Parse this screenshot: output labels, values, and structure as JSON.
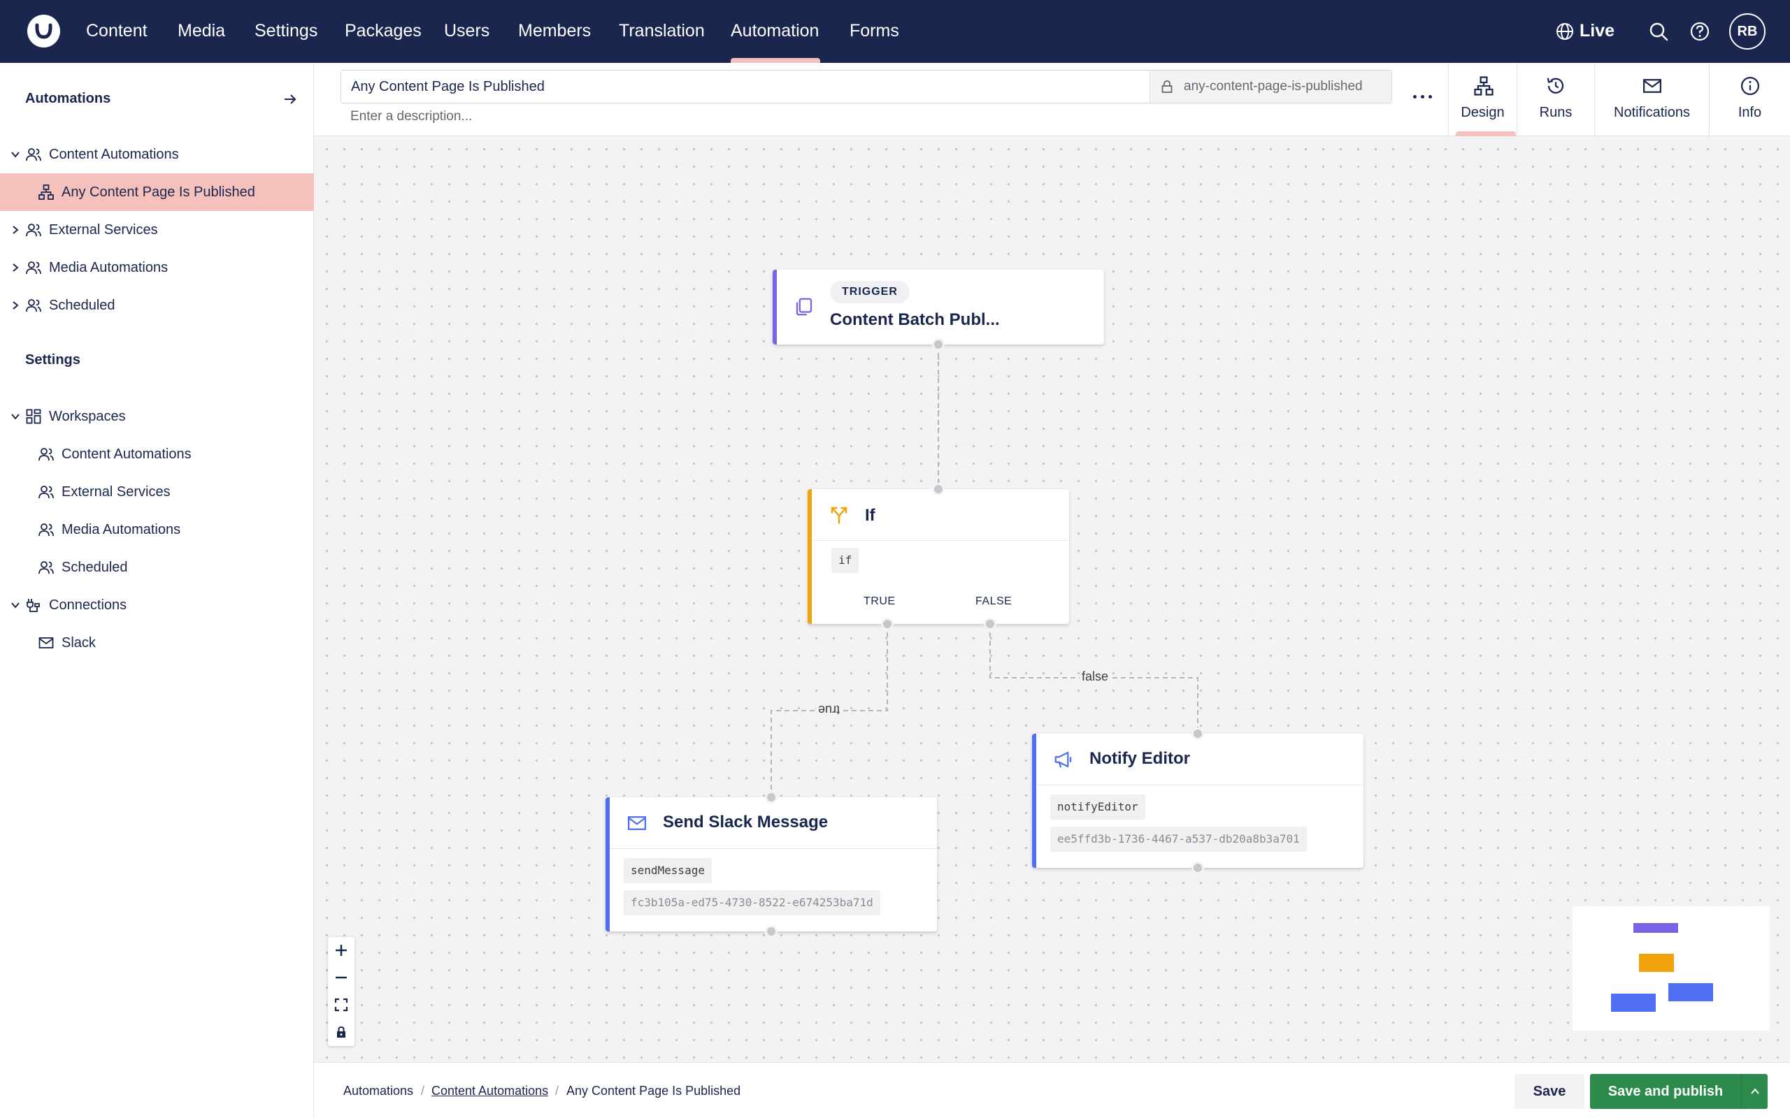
{
  "nav": {
    "items": [
      "Content",
      "Media",
      "Settings",
      "Packages",
      "Users",
      "Members",
      "Translation",
      "Automation",
      "Forms"
    ],
    "active": "Automation",
    "live_label": "Live",
    "avatar_initials": "RB"
  },
  "sidebar": {
    "automations_heading": "Automations",
    "automation_groups": [
      {
        "label": "Content Automations",
        "expanded": true
      },
      {
        "label": "Any Content Page Is Published",
        "selected": true
      },
      {
        "label": "External Services",
        "expanded": false
      },
      {
        "label": "Media Automations",
        "expanded": false
      },
      {
        "label": "Scheduled",
        "expanded": false
      }
    ],
    "settings_heading": "Settings",
    "settings_tree": [
      {
        "label": "Workspaces"
      },
      {
        "label": "Content Automations"
      },
      {
        "label": "External Services"
      },
      {
        "label": "Media Automations"
      },
      {
        "label": "Scheduled"
      },
      {
        "label": "Connections"
      },
      {
        "label": "Slack"
      }
    ]
  },
  "header": {
    "name_value": "Any Content Page Is Published",
    "alias": "any-content-page-is-published",
    "description_placeholder": "Enter a description...",
    "tabs": [
      {
        "label": "Design",
        "icon": "flow-icon",
        "active": true
      },
      {
        "label": "Runs",
        "icon": "history-icon"
      },
      {
        "label": "Notifications",
        "icon": "mail-icon"
      },
      {
        "label": "Info",
        "icon": "info-icon"
      }
    ]
  },
  "canvas": {
    "trigger": {
      "badge": "TRIGGER",
      "title": "Content Batch Publ...",
      "icon": "copy-icon",
      "accent": "#7564e6"
    },
    "if_node": {
      "title": "If",
      "alias": "if",
      "true_label": "TRUE",
      "false_label": "FALSE",
      "icon": "split-icon",
      "accent": "#f0a30c"
    },
    "slack_node": {
      "title": "Send Slack Message",
      "alias": "sendMessage",
      "id": "fc3b105a-ed75-4730-8522-e674253ba71d",
      "icon": "mail-icon",
      "accent": "#4f6ff0"
    },
    "notify_node": {
      "title": "Notify Editor",
      "alias": "notifyEditor",
      "id": "ee5ffd3b-1736-4467-a537-db20a8b3a701",
      "icon": "megaphone-icon",
      "accent": "#4f6ff0"
    },
    "edge_true_label": "true",
    "edge_false_label": "false"
  },
  "footer": {
    "breadcrumb": [
      "Automations",
      "Content Automations",
      "Any Content Page Is Published"
    ],
    "save_label": "Save",
    "publish_label": "Save and publish"
  },
  "colors": {
    "brand_nav": "#1b264f",
    "selected_highlight": "#f5c1bc",
    "publish_green": "#2b8a4c",
    "trigger_purple": "#7564e6",
    "condition_orange": "#f0a30c",
    "action_blue": "#4f6ff0"
  }
}
